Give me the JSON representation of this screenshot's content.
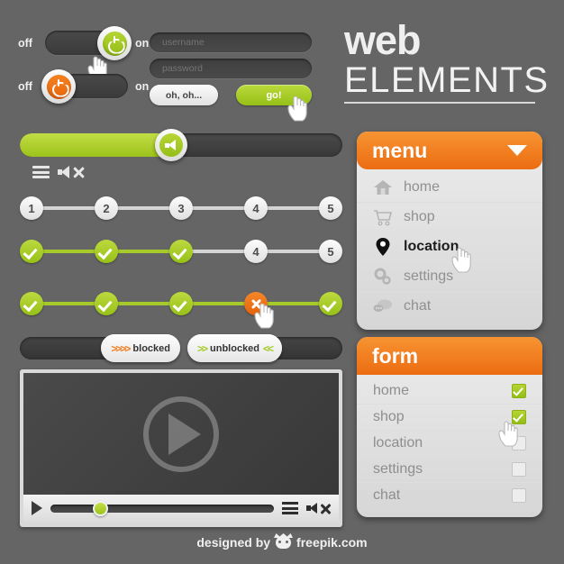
{
  "title": {
    "line1": "web",
    "line2": "ELEMENTS"
  },
  "toggles": [
    {
      "off_label": "off",
      "on_label": "on",
      "state": "on",
      "color": "#a5ca2a",
      "icon": "power-icon"
    },
    {
      "off_label": "off",
      "on_label": "on",
      "state": "off",
      "color": "#ef7f22",
      "icon": "power-icon"
    }
  ],
  "login": {
    "username_placeholder": "username",
    "password_placeholder": "password",
    "cancel_label": "oh, oh...",
    "submit_label": "go!"
  },
  "volume": {
    "value": 47,
    "handle_icon": "speaker-icon",
    "menu_icon": "hamburger-icon",
    "mute_icon": "speaker-mute-icon"
  },
  "steppers": [
    {
      "name": "numbered",
      "nodes": [
        {
          "label": "1",
          "state": "plain"
        },
        {
          "label": "2",
          "state": "plain"
        },
        {
          "label": "3",
          "state": "plain"
        },
        {
          "label": "4",
          "state": "plain"
        },
        {
          "label": "5",
          "state": "plain"
        }
      ],
      "progress": 0
    },
    {
      "name": "partial",
      "nodes": [
        {
          "label": "",
          "state": "done"
        },
        {
          "label": "",
          "state": "done"
        },
        {
          "label": "",
          "state": "done"
        },
        {
          "label": "4",
          "state": "plain"
        },
        {
          "label": "5",
          "state": "plain"
        }
      ],
      "progress": 50
    },
    {
      "name": "error",
      "nodes": [
        {
          "label": "",
          "state": "done"
        },
        {
          "label": "",
          "state": "done"
        },
        {
          "label": "",
          "state": "done"
        },
        {
          "label": "",
          "state": "err"
        },
        {
          "label": "",
          "state": "done"
        }
      ],
      "progress": 100
    }
  ],
  "block_sliders": [
    {
      "label": "blocked",
      "chevrons": ">>>>",
      "chevron_color": "#ef7f22",
      "position": "right",
      "chevrons_after": ""
    },
    {
      "label": "unblocked",
      "chevrons": ">>",
      "chevron_color": "#a5ca2a",
      "position": "left",
      "chevrons_after": "<<"
    }
  ],
  "video": {
    "play_icon": "play-icon",
    "progress": 22,
    "menu_icon": "hamburger-icon",
    "mute_icon": "speaker-mute-icon"
  },
  "menu_panel": {
    "title": "menu",
    "caret_icon": "chevron-down-icon",
    "items": [
      {
        "label": "home",
        "icon": "home-icon",
        "active": false
      },
      {
        "label": "shop",
        "icon": "cart-icon",
        "active": false
      },
      {
        "label": "location",
        "icon": "map-pin-icon",
        "active": true
      },
      {
        "label": "settings",
        "icon": "gears-icon",
        "active": false
      },
      {
        "label": "chat",
        "icon": "chat-icon",
        "active": false
      }
    ]
  },
  "form_panel": {
    "title": "form",
    "items": [
      {
        "label": "home",
        "checked": true
      },
      {
        "label": "shop",
        "checked": true
      },
      {
        "label": "location",
        "checked": false
      },
      {
        "label": "settings",
        "checked": false
      },
      {
        "label": "chat",
        "checked": false
      }
    ]
  },
  "footer": {
    "prefix": "designed by",
    "brand": "freepik.com",
    "logo_icon": "freepik-logo-icon"
  },
  "colors": {
    "background": "#656565",
    "green": "#a5ca2a",
    "orange": "#ef7f22",
    "panel": "#e6e6e6"
  }
}
